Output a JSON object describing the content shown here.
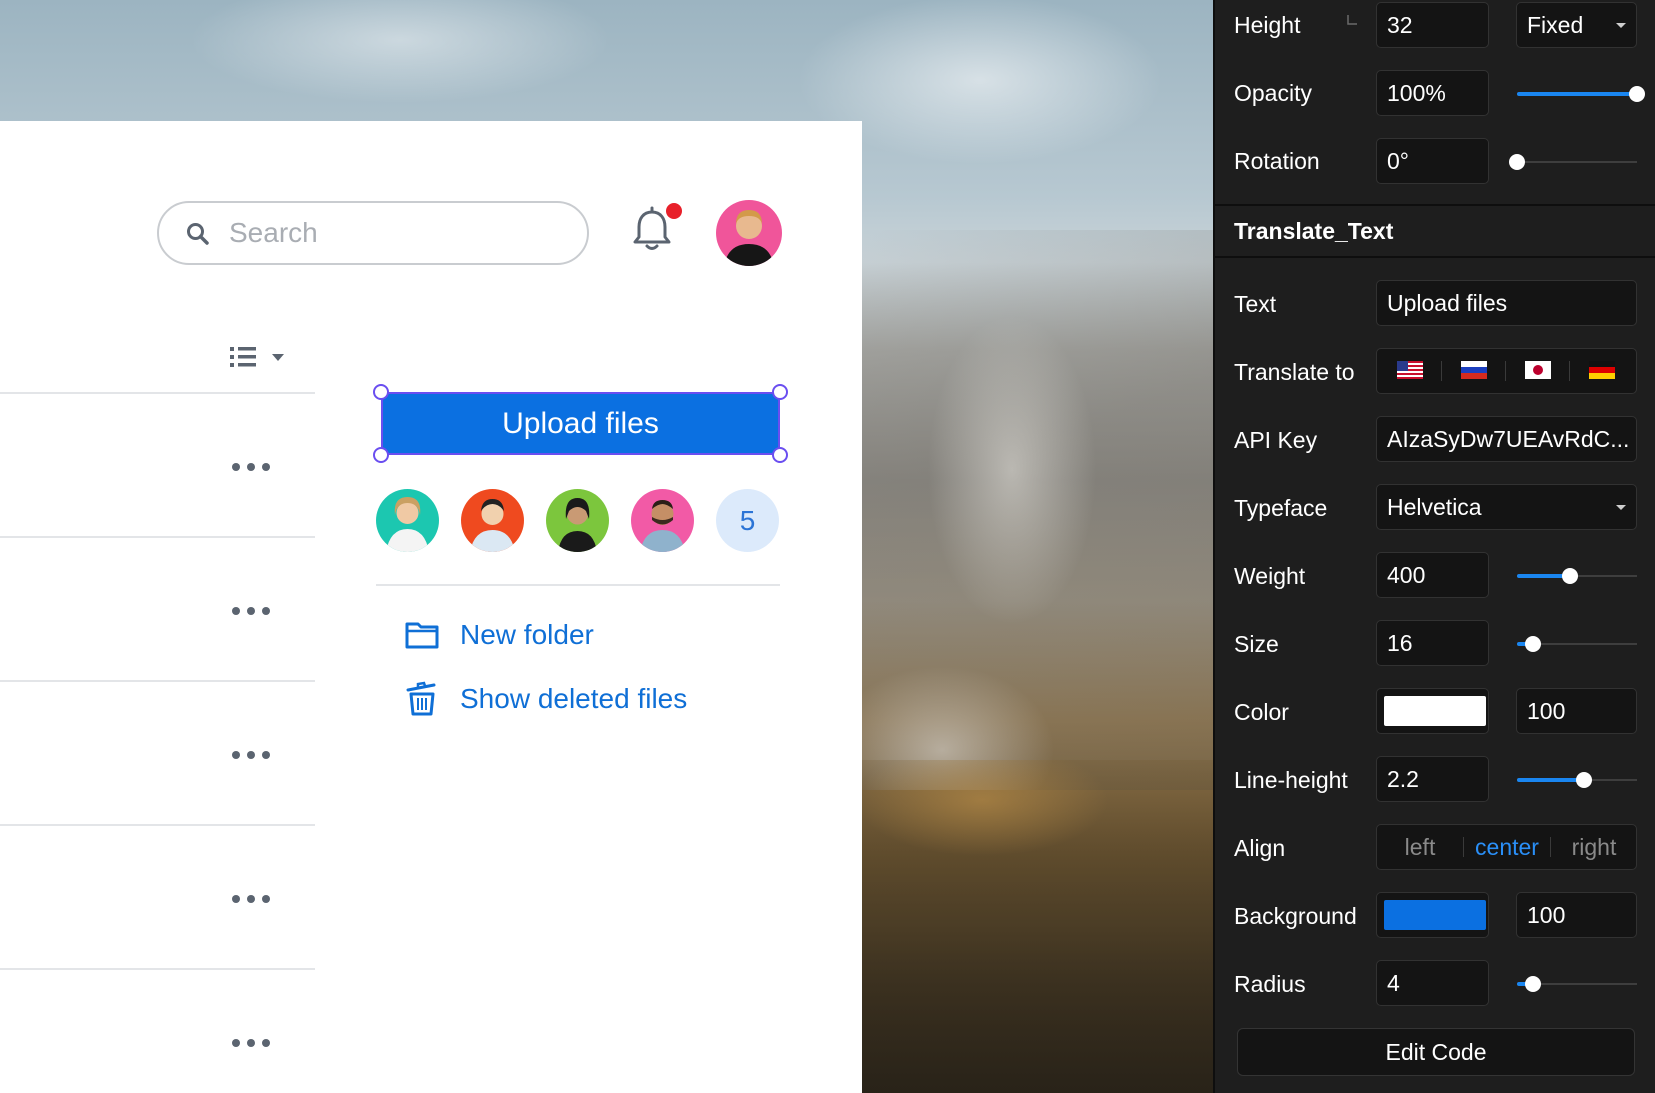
{
  "app": {
    "search": {
      "placeholder": "Search"
    },
    "upload_button": {
      "label": "Upload files",
      "background": "#0b70e1"
    },
    "members": {
      "avatars": [
        {
          "name": "member-1",
          "bg": "#1cc7b0"
        },
        {
          "name": "member-2",
          "bg": "#ef4a1f"
        },
        {
          "name": "member-3",
          "bg": "#7cc63d"
        },
        {
          "name": "member-4",
          "bg": "#f25aa6"
        }
      ],
      "extra_count": "5"
    },
    "actions": {
      "new_folder": "New folder",
      "show_deleted": "Show deleted files"
    },
    "accent": "#0f6fd6",
    "notification_dot": "#e8202a"
  },
  "inspector": {
    "height": {
      "label": "Height",
      "value": "32",
      "mode": "Fixed"
    },
    "opacity": {
      "label": "Opacity",
      "value": "100%",
      "level": 1.0
    },
    "rotation": {
      "label": "Rotation",
      "value": "0°",
      "level": 0.0
    },
    "section_title": "Translate_Text",
    "text": {
      "label": "Text",
      "value": "Upload files"
    },
    "translate_to": {
      "label": "Translate to",
      "flags": [
        "us-flag",
        "ru-flag",
        "jp-flag",
        "de-flag"
      ]
    },
    "api_key": {
      "label": "API Key",
      "value": "AIzaSyDw7UEAvRdC..."
    },
    "typeface": {
      "label": "Typeface",
      "value": "Helvetica"
    },
    "weight": {
      "label": "Weight",
      "value": "400",
      "level": 0.44
    },
    "size": {
      "label": "Size",
      "value": "16",
      "level": 0.13
    },
    "color": {
      "label": "Color",
      "swatch": "#ffffff",
      "opacity": "100"
    },
    "line_height": {
      "label": "Line-height",
      "value": "2.2",
      "level": 0.56
    },
    "align": {
      "label": "Align",
      "options": [
        "left",
        "center",
        "right"
      ],
      "selected": "center"
    },
    "background": {
      "label": "Background",
      "swatch": "#0b70e1",
      "opacity": "100"
    },
    "radius": {
      "label": "Radius",
      "value": "4",
      "level": 0.13
    },
    "edit_code": "Edit Code"
  }
}
